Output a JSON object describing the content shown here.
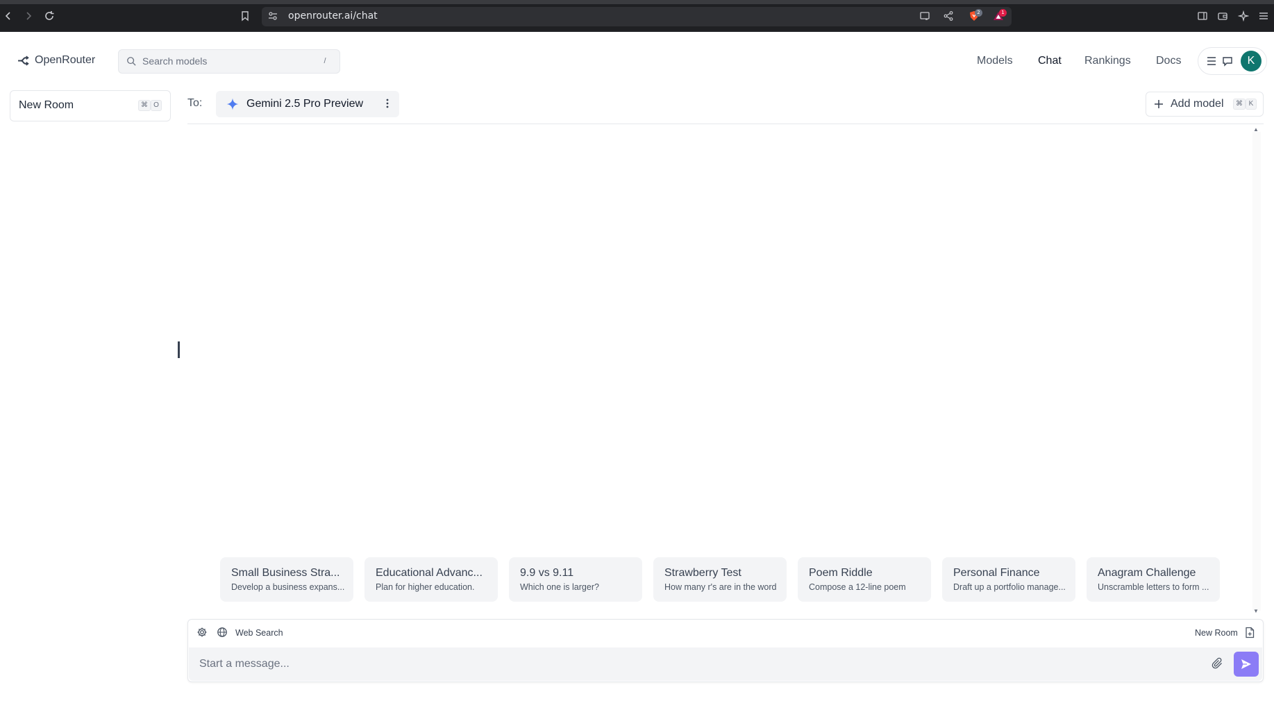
{
  "browser": {
    "url": "openrouter.ai/chat",
    "brave_badge": "2",
    "alert_badge": "1"
  },
  "header": {
    "logo_text": "OpenRouter",
    "search_placeholder": "Search models",
    "search_shortcut": "/",
    "nav": [
      "Models",
      "Chat",
      "Rankings",
      "Docs"
    ],
    "active_nav": "Chat",
    "avatar_letter": "K"
  },
  "sidebar": {
    "new_room_label": "New Room",
    "new_room_shortcut": [
      "⌘",
      "O"
    ]
  },
  "chat": {
    "to_label": "To:",
    "model_name": "Gemini 2.5 Pro Preview",
    "add_model_label": "Add model",
    "add_model_shortcut": [
      "⌘",
      "K"
    ]
  },
  "suggestions": [
    {
      "title": "Small Business Stra...",
      "subtitle": "Develop a business expans..."
    },
    {
      "title": "Educational Advanc...",
      "subtitle": "Plan for higher education."
    },
    {
      "title": "9.9 vs 9.11",
      "subtitle": "Which one is larger?"
    },
    {
      "title": "Strawberry Test",
      "subtitle": "How many r's are in the word"
    },
    {
      "title": "Poem Riddle",
      "subtitle": "Compose a 12-line poem"
    },
    {
      "title": "Personal Finance",
      "subtitle": "Draft up a portfolio manage..."
    },
    {
      "title": "Anagram Challenge",
      "subtitle": "Unscramble letters to form ..."
    }
  ],
  "composer": {
    "web_search_label": "Web Search",
    "new_room_label": "New Room",
    "placeholder": "Start a message..."
  },
  "colors": {
    "accent_send": "#8b7cf6",
    "avatar": "#0f766e",
    "gemini_star": "#4f7cf0"
  }
}
